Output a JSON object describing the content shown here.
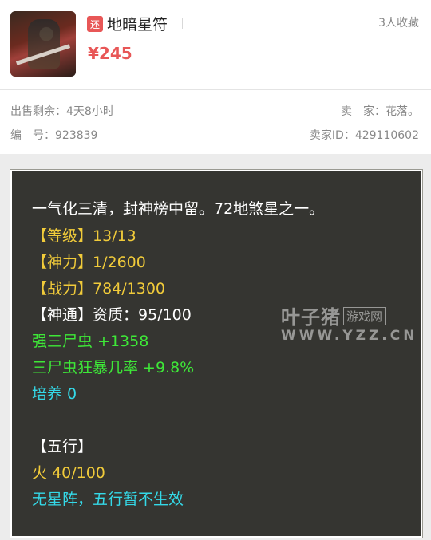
{
  "item": {
    "badge": "还",
    "name": "地暗星符",
    "favorites": "3人收藏",
    "price": "¥245"
  },
  "meta": {
    "time_left": "出售剩余：4天8小时",
    "seller": "卖　家：花落。",
    "serial": "编　号：923839",
    "seller_id": "卖家ID：429110602"
  },
  "details": {
    "lines": [
      {
        "text": "一气化三清，封神榜中留。72地煞星之一。",
        "color": "white"
      },
      {
        "text": "【等级】13/13",
        "color": "yellow"
      },
      {
        "text": "【神力】1/2600",
        "color": "yellow"
      },
      {
        "text": "【战力】784/1300",
        "color": "yellow"
      },
      {
        "text": "【神通】资质：95/100",
        "color": "white"
      },
      {
        "text": "强三尸虫 +1358",
        "color": "green"
      },
      {
        "text": "三尸虫狂暴几率 +9.8%",
        "color": "green"
      },
      {
        "text": "培养 0",
        "color": "cyan"
      },
      {
        "text": "【五行】",
        "color": "white"
      },
      {
        "text": "火 40/100",
        "color": "yellow"
      },
      {
        "text": "无星阵，五行暂不生效",
        "color": "cyan"
      }
    ]
  },
  "watermark": {
    "brand": "叶子猪",
    "tag": "游戏网",
    "url": "WWW.YZZ.CN"
  },
  "icons": {
    "thumbnail": "character-portrait-icon"
  }
}
